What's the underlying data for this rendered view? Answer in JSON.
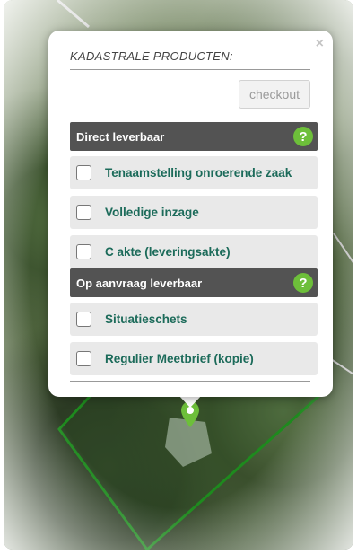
{
  "popup": {
    "title": "KADASTRALE PRODUCTEN:",
    "close_glyph": "×",
    "checkout_label": "checkout"
  },
  "sections": [
    {
      "title": "Direct leverbaar",
      "help_glyph": "?",
      "items": [
        {
          "label": "Tenaamstelling onroerende zaak",
          "checked": false
        },
        {
          "label": "Volledige inzage",
          "checked": false
        },
        {
          "label": "C akte (leveringsakte)",
          "checked": false
        }
      ]
    },
    {
      "title": "Op aanvraag leverbaar",
      "help_glyph": "?",
      "items": [
        {
          "label": "Situatieschets",
          "checked": false
        },
        {
          "label": "Regulier Meetbrief (kopie)",
          "checked": false
        }
      ]
    }
  ],
  "colors": {
    "section_header_bg": "#535353",
    "help_icon": "#6dbf3a",
    "item_label": "#1c6b5a",
    "parcel_outline": "#1e8a1e"
  },
  "icons": {
    "close": "close-icon",
    "help": "help-icon",
    "marker": "map-marker-icon"
  }
}
